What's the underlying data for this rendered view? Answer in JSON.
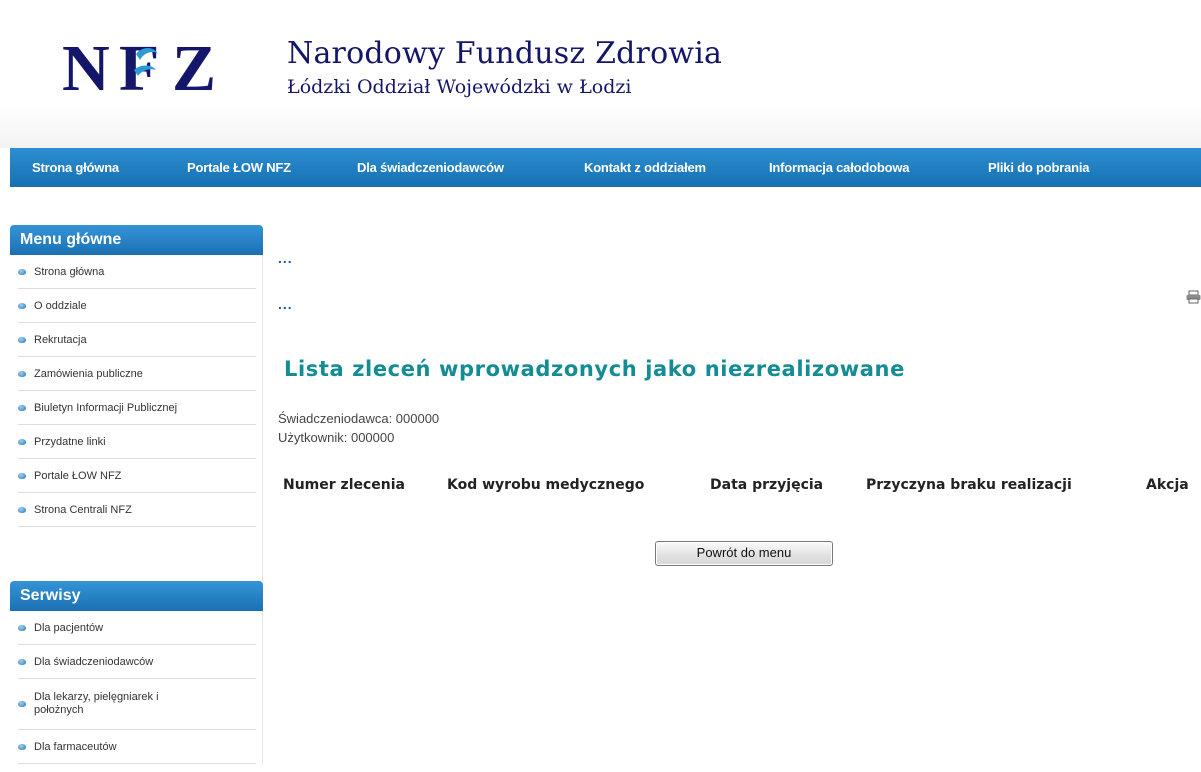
{
  "header": {
    "logo_text": "NFZ",
    "org_name": "Narodowy Fundusz Zdrowia",
    "org_sub": "Łódzki Oddział Wojewódzki w Łodzi",
    "brand_color": "#14166a"
  },
  "nav": {
    "items": [
      "Strona główna",
      "Portale ŁOW NFZ",
      "Dla świadczeniodawców",
      "Kontakt z oddziałem",
      "Informacja całodobowa",
      "Pliki do pobrania"
    ],
    "color": "#1b77b9"
  },
  "sidebar": {
    "main_menu": {
      "title": "Menu główne",
      "items": [
        "Strona główna",
        "O oddziale",
        "Rekrutacja",
        "Zamówienia publiczne",
        "Biuletyn Informacji Publicznej",
        "Przydatne linki",
        "Portale ŁOW NFZ",
        "Strona Centrali NFZ"
      ]
    },
    "services": {
      "title": "Serwisy",
      "items": [
        "Dla pacjentów",
        "Dla świadczeniodawców",
        "Dla lekarzy, pielęgniarek i położnych",
        "Dla farmaceutów"
      ]
    }
  },
  "main": {
    "breadcrumb_1": "...",
    "breadcrumb_2": "...",
    "title": "Lista zleceń wprowadzonych jako niezrealizowane",
    "provider": "Świadczeniodawca: 000000",
    "user": "Użytkownik: 000000",
    "table_headers": [
      "Numer zlecenia",
      "Kod wyrobu medycznego",
      "Data przyjęcia",
      "Przyczyna braku realizacji",
      "Akcja"
    ],
    "back_button": "Powrót do menu",
    "title_color": "#138c93",
    "print_icon": "printer-icon"
  }
}
